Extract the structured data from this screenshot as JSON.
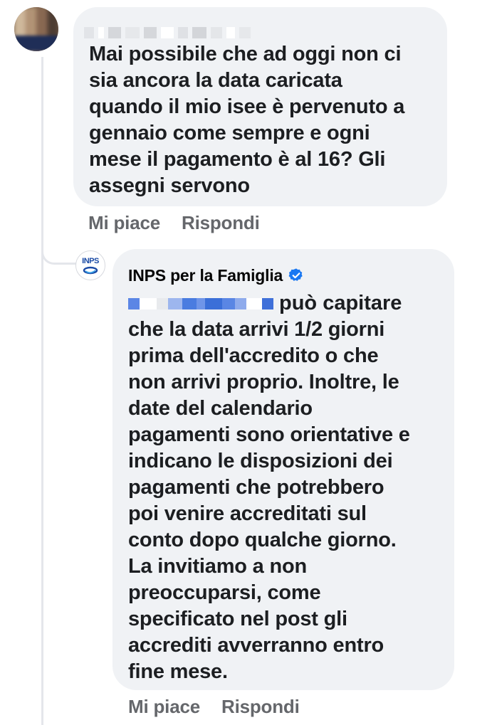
{
  "thread": {
    "comment": {
      "text": "Mai possibile che ad oggi non ci\nsia ancora la data caricata\nquando il mio isee è pervenuto a\ngennaio come sempre e ogni\nmese il pagamento è al 16? Gli\nassegni servono",
      "actions": {
        "like_label": "Mi piace",
        "reply_label": "Rispondi"
      }
    },
    "reply": {
      "author": "INPS per la Famiglia",
      "avatar_logo_text": "INPS",
      "verified": true,
      "first_line_tail": "può capitare",
      "text": "che la data arrivi 1/2 giorni\nprima dell'accredito o che\nnon arrivi proprio. Inoltre, le\ndate del calendario\npagamenti sono orientative e\nindicano le disposizioni dei\npagamenti che potrebbero\npoi venire accreditati sul\nconto dopo qualche giorno.\nLa invitiamo a non\npreoccuparsi, come\nspecificato nel post gli\naccrediti avverranno entro\nfine mese.",
      "actions": {
        "like_label": "Mi piace",
        "reply_label": "Rispondi"
      }
    }
  },
  "colors": {
    "bubble_bg": "#f0f2f5",
    "text": "#1c1e21",
    "secondary_text": "#65676b",
    "verified_blue": "#1877f2",
    "mention_blue": "#3b6fd8",
    "inps_blue": "#1a4aa5"
  }
}
